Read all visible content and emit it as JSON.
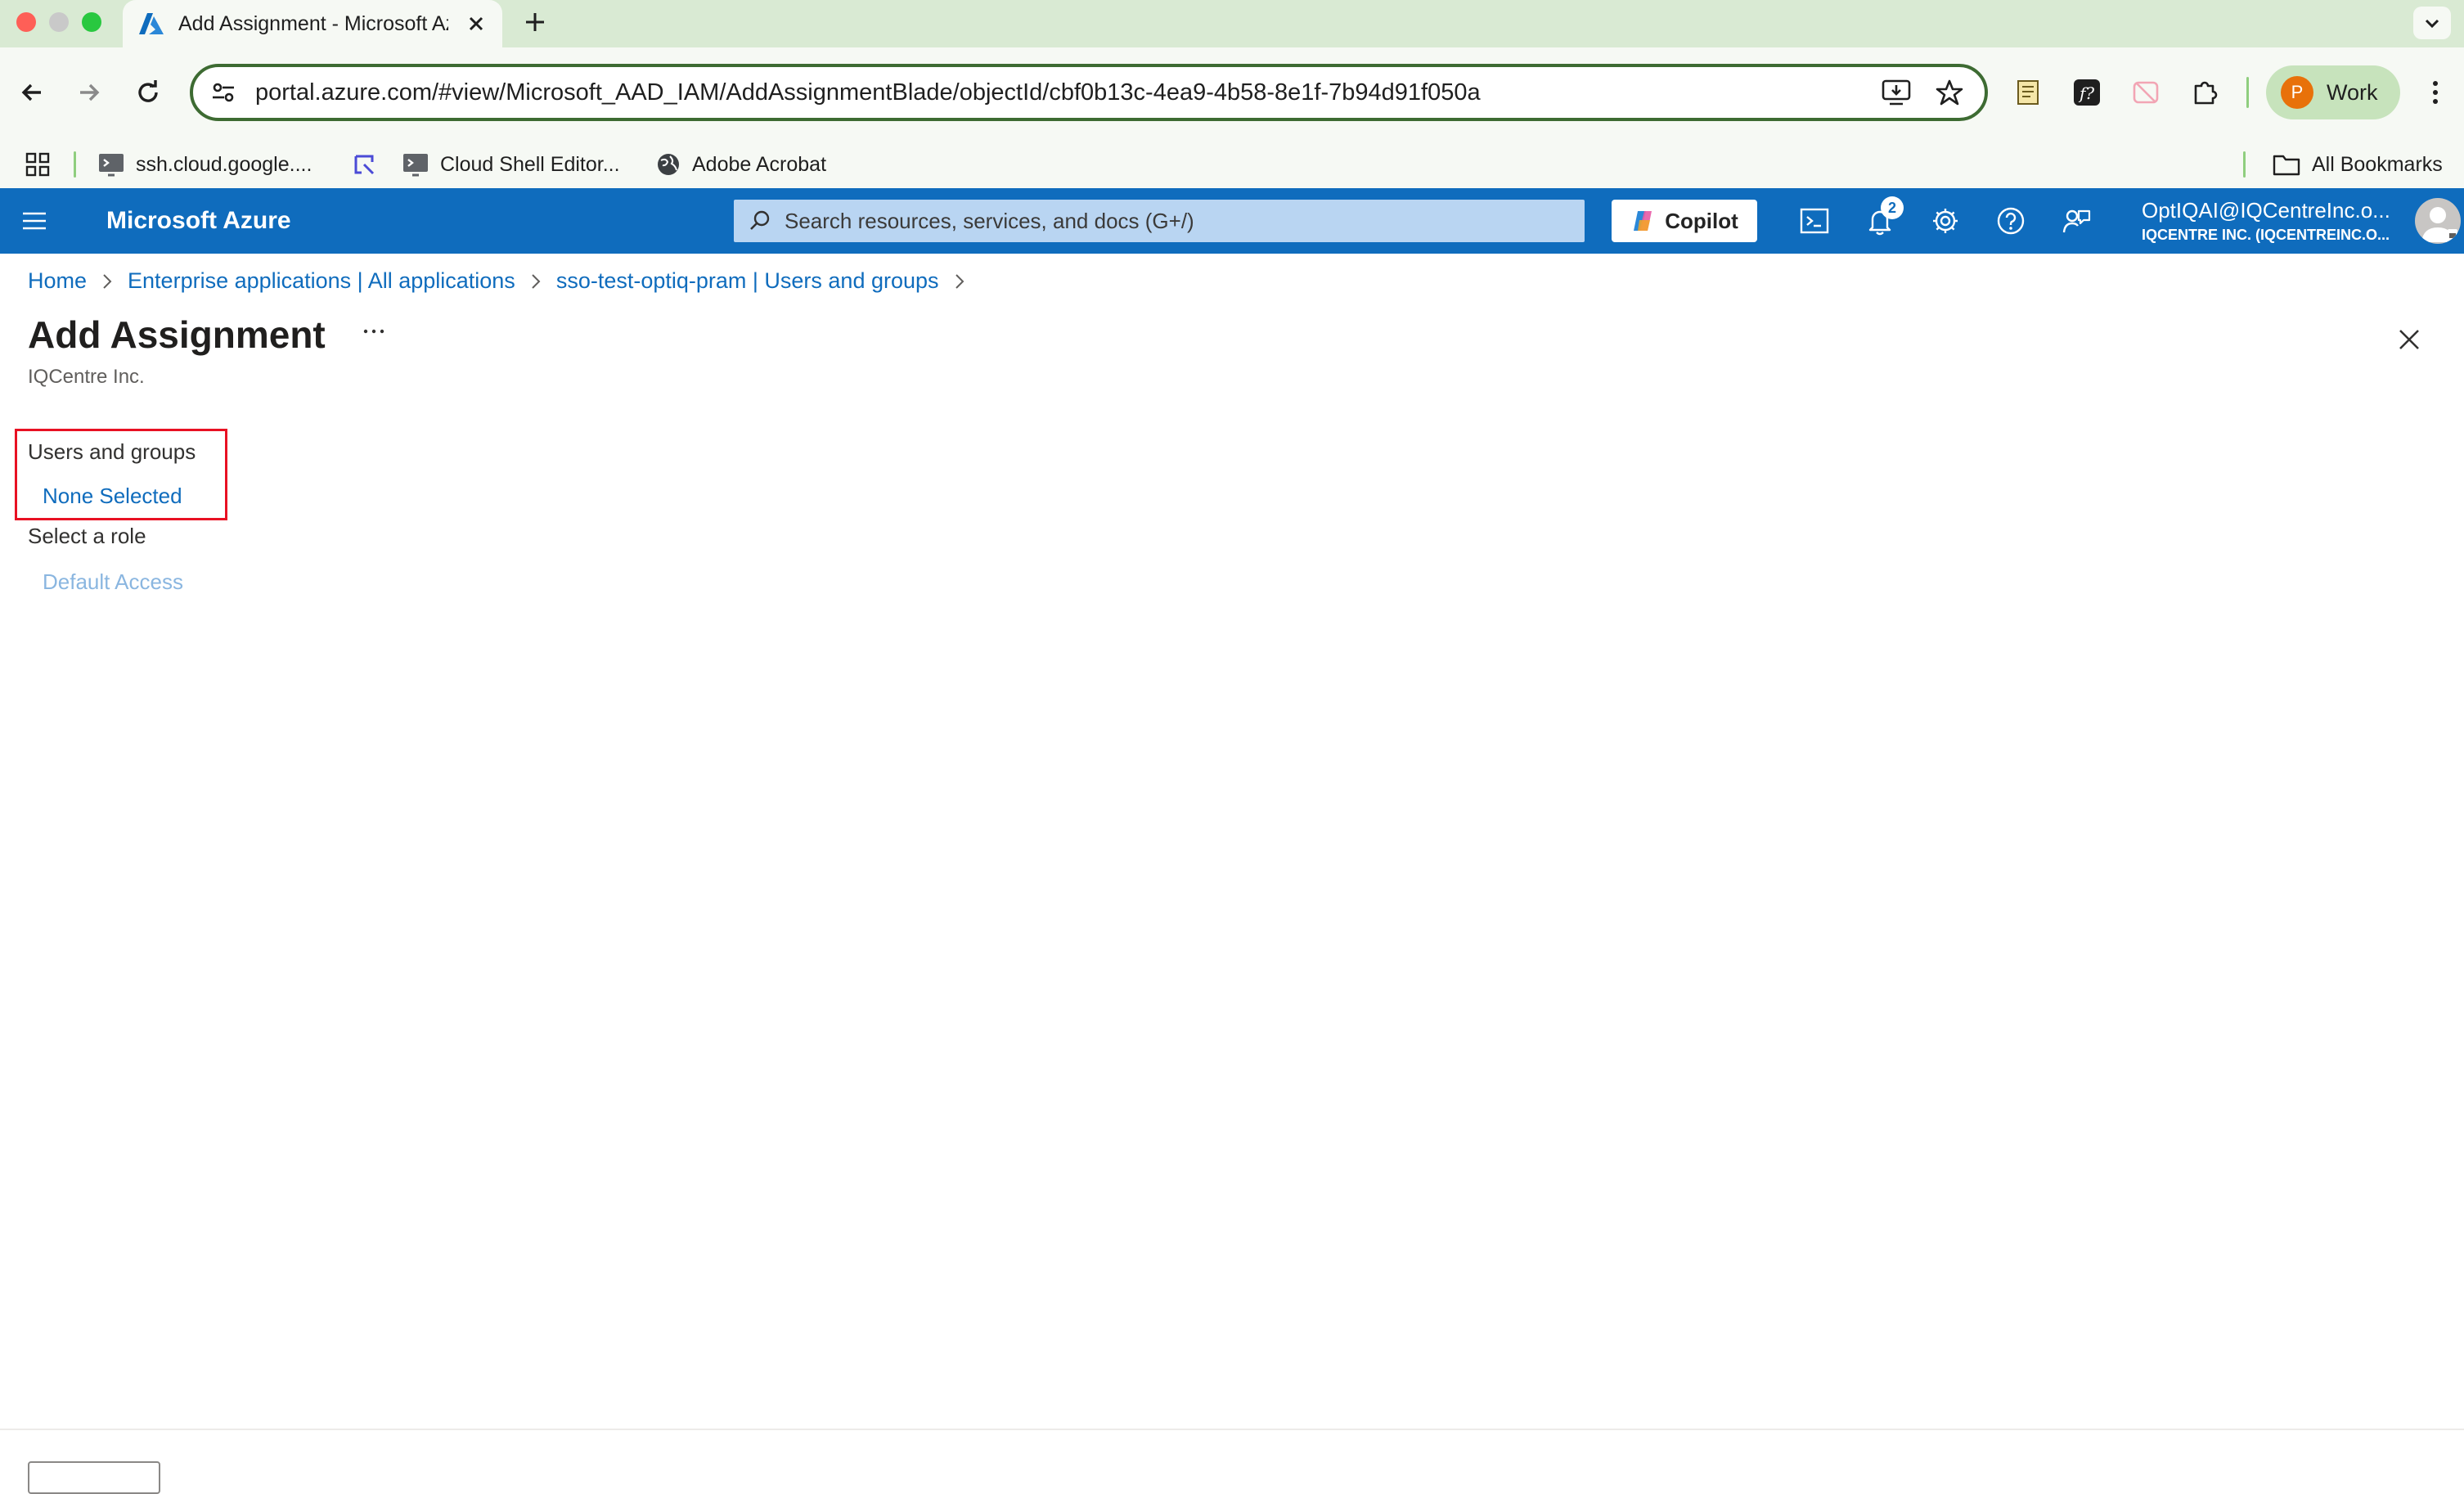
{
  "browser": {
    "tab_title": "Add Assignment - Microsoft Azure",
    "url": "portal.azure.com/#view/Microsoft_AAD_IAM/AddAssignmentBlade/objectId/cbf0b13c-4ea9-4b58-8e1f-7b94d91f050a",
    "profile_initial": "P",
    "profile_label": "Work",
    "bookmarks": [
      {
        "label": "ssh.cloud.google....",
        "icon": "terminal-icon"
      },
      {
        "label": "",
        "icon": "extension-app-icon"
      },
      {
        "label": "Cloud Shell Editor...",
        "icon": "terminal-icon"
      },
      {
        "label": "Adobe Acrobat",
        "icon": "globe-icon"
      }
    ],
    "all_bookmarks_label": "All Bookmarks"
  },
  "azure_header": {
    "brand": "Microsoft Azure",
    "search_placeholder": "Search resources, services, and docs (G+/)",
    "copilot_label": "Copilot",
    "notification_count": "2",
    "account_name": "OptIQAI@IQCentreInc.o...",
    "account_tenant": "IQCENTRE INC. (IQCENTREINC.O..."
  },
  "breadcrumb": [
    "Home",
    "Enterprise applications | All applications",
    "sso-test-optiq-pram | Users and groups"
  ],
  "page": {
    "title": "Add Assignment",
    "more_label": "...",
    "subtitle": "IQCentre Inc.",
    "users_groups_label": "Users and groups",
    "users_groups_value": "None Selected",
    "role_label": "Select a role",
    "role_value": "Default Access"
  },
  "colors": {
    "azure_blue": "#0f6cbd",
    "highlight_red": "#e81123",
    "tab_strip_green": "#d9ead3"
  }
}
